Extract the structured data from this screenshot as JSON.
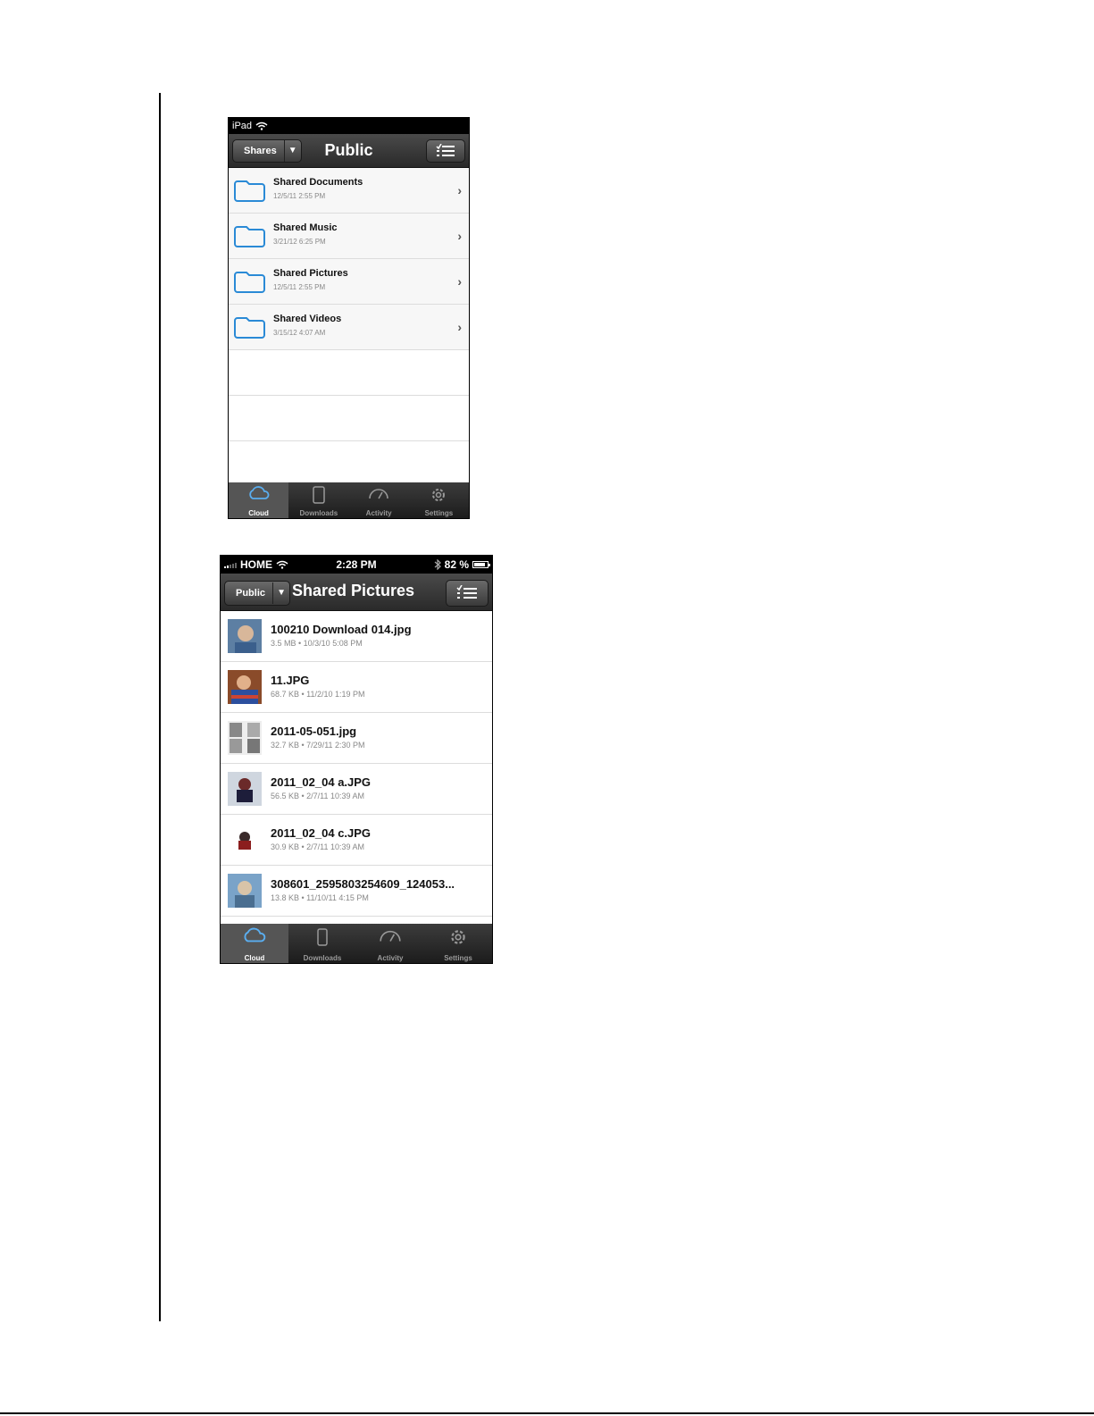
{
  "screen1": {
    "status": {
      "device": "iPad"
    },
    "nav": {
      "back": "Shares",
      "title": "Public"
    },
    "rows": [
      {
        "title": "Shared Documents",
        "subtitle": "12/5/11 2:55 PM"
      },
      {
        "title": "Shared Music",
        "subtitle": "3/21/12 6:25 PM"
      },
      {
        "title": "Shared Pictures",
        "subtitle": "12/5/11 2:55 PM"
      },
      {
        "title": "Shared Videos",
        "subtitle": "3/15/12 4:07 AM"
      }
    ],
    "tabs": [
      "Cloud",
      "Downloads",
      "Activity",
      "Settings"
    ]
  },
  "screen2": {
    "status": {
      "carrier": "HOME",
      "time": "2:28 PM",
      "battery": "82 %"
    },
    "nav": {
      "back": "Public",
      "title": "Shared Pictures"
    },
    "rows": [
      {
        "title": "100210 Download 014.jpg",
        "subtitle": "3.5 MB  •  10/3/10 5:08 PM"
      },
      {
        "title": "11.JPG",
        "subtitle": "68.7 KB  •  11/2/10 1:19 PM"
      },
      {
        "title": "2011-05-051.jpg",
        "subtitle": "32.7 KB  •  7/29/11 2:30 PM"
      },
      {
        "title": "2011_02_04 a.JPG",
        "subtitle": "56.5 KB  •  2/7/11 10:39 AM"
      },
      {
        "title": "2011_02_04 c.JPG",
        "subtitle": "30.9 KB  •  2/7/11 10:39 AM"
      },
      {
        "title": "308601_2595803254609_124053...",
        "subtitle": "13.8 KB  •  11/10/11 4:15 PM"
      }
    ],
    "tabs": [
      "Cloud",
      "Downloads",
      "Activity",
      "Settings"
    ]
  },
  "colors": {
    "folder_blue": "#2a8ad6",
    "nav_dark": "#2a2a2a"
  }
}
